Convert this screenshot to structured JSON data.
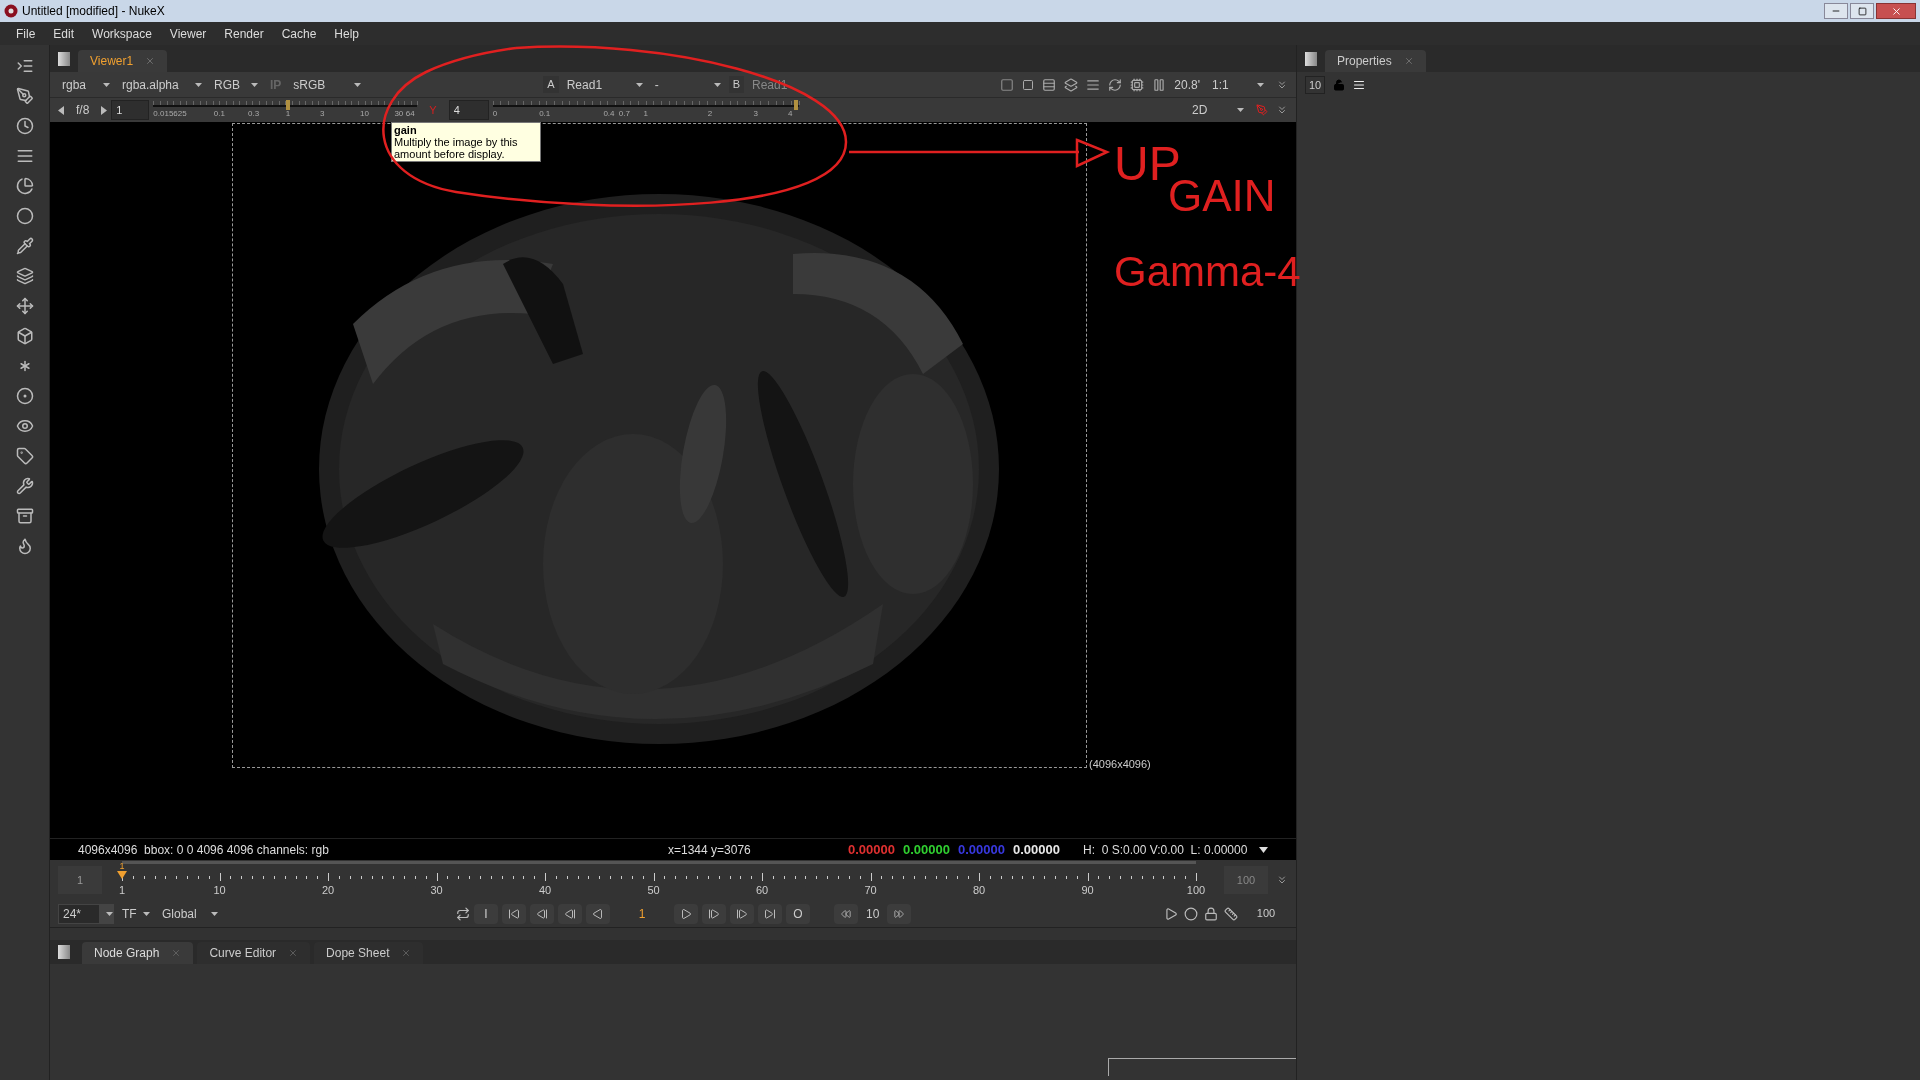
{
  "window": {
    "title": "Untitled [modified] - NukeX"
  },
  "menu": [
    "File",
    "Edit",
    "Workspace",
    "Viewer",
    "Render",
    "Cache",
    "Help"
  ],
  "viewer_tab": {
    "label": "Viewer1",
    "selected": true
  },
  "viewer_toolbar": {
    "channels": "rgba",
    "alpha_channel": "rgba.alpha",
    "display": "RGB",
    "ip": "IP",
    "lut": "sRGB",
    "a_label": "A",
    "a_input": "Read1",
    "operation": "-",
    "b_label": "B",
    "b_input": "Read1",
    "zoom_reading": "20.8'",
    "zoom": "1:1"
  },
  "exposure_bar": {
    "fstop": "f/8",
    "gain_value": "1",
    "gain_slider": {
      "level": 0.51
    },
    "gain_ticks": [
      "0.015625",
      "0.1",
      "0.3",
      "1",
      "3",
      "10",
      "30",
      "64"
    ],
    "gamma_label": "Y",
    "gamma_value": "4",
    "gamma_slider": {
      "level": 0.99
    },
    "gamma_ticks": [
      "0",
      "0.1",
      "0.4",
      "0.7",
      "1",
      "2",
      "3",
      "4"
    ],
    "view_mode": "2D"
  },
  "tooltip": {
    "title": "gain",
    "text": "Multiply the image by this amount before display."
  },
  "viewer": {
    "format": "(4096x4096)"
  },
  "info_bar": {
    "format": "4096x4096  bbox: 0 0 4096 4096 channels: rgb",
    "position": "x=1344 y=3076",
    "pixel_values": [
      {
        "text": "0.00000",
        "color": "#e03030"
      },
      {
        "text": "0.00000",
        "color": "#30d030"
      },
      {
        "text": "0.00000",
        "color": "#3838e0"
      },
      {
        "text": "0.00000",
        "color": "#e8e8e8"
      }
    ],
    "hsvl": "H:  0 S:0.00 V:0.00  L: 0.00000"
  },
  "timeline": {
    "start": "1",
    "current_label": "1",
    "level": 0,
    "ticks": [
      "1",
      "10",
      "20",
      "30",
      "40",
      "50",
      "60",
      "70",
      "80",
      "90",
      "100"
    ],
    "end": "100"
  },
  "transport": {
    "fps": "24*",
    "tf": "TF",
    "scope": "Global",
    "in_key": "I",
    "frame": "1",
    "out_key": "O",
    "increment": "10",
    "end_frame": "100"
  },
  "bottom_tabs": [
    {
      "label": "Node Graph",
      "selected": true
    },
    {
      "label": "Curve Editor",
      "selected": false
    },
    {
      "label": "Dope Sheet",
      "selected": false
    }
  ],
  "properties": {
    "tab": "Properties",
    "max_panels": "10"
  },
  "annotations": {
    "line_1": "UP",
    "line_2": "GAIN",
    "line_3": "Gamma-4"
  }
}
